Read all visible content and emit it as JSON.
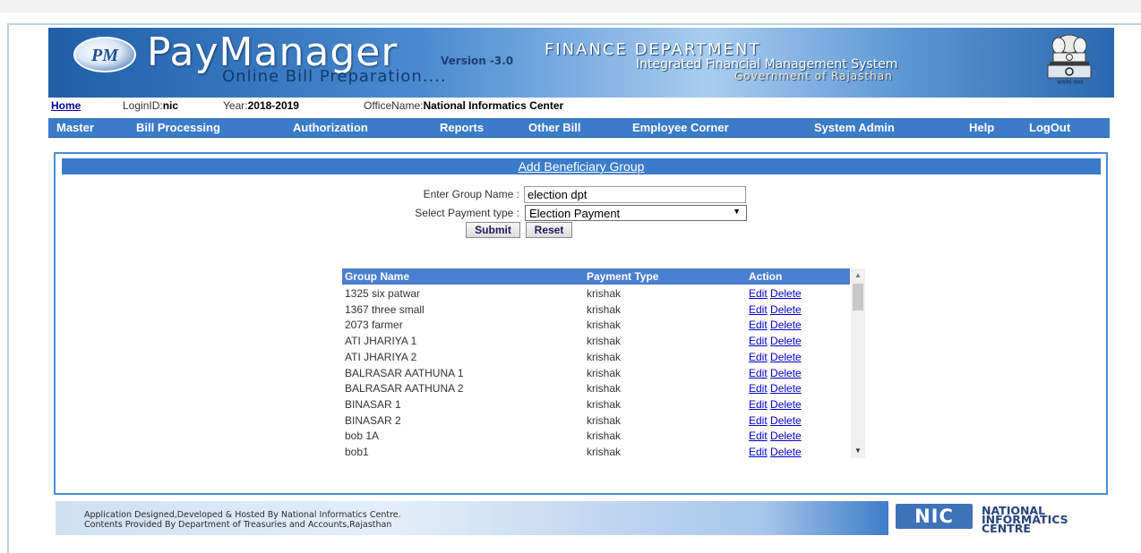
{
  "header": {
    "logo_initials": "PM",
    "brand": "PayManager",
    "version": "Version -3.0",
    "subtitle": "Online Bill Preparation....",
    "department": "FINANCE  DEPARTMENT",
    "system": "Integrated Financial Management System",
    "government": "Government of Rajasthan",
    "emblem_caption": "सत्यमेव जयते",
    "brand_color": "#1f5fa8"
  },
  "infobar": {
    "home_label": "Home",
    "login_label": "LoginID:",
    "login_value": "nic",
    "year_label": "Year:",
    "year_value": "2018-2019",
    "office_label": "OfficeName:",
    "office_value": "National Informatics Center"
  },
  "menu": {
    "items": [
      "Master",
      "Bill Processing",
      "Authorization",
      "Reports",
      "Other Bill",
      "Employee Corner",
      "System Admin",
      "Help",
      "LogOut"
    ]
  },
  "panel": {
    "title": "Add Beneficiary Group"
  },
  "form": {
    "group_name_label": "Enter Group Name :",
    "group_name_value": "election dpt",
    "payment_type_label": "Select Payment type :",
    "payment_type_value": "Election Payment",
    "submit_label": "Submit",
    "reset_label": "Reset"
  },
  "grid": {
    "columns": [
      "Group Name",
      "Payment Type",
      "Action"
    ],
    "edit_label": "Edit",
    "delete_label": "Delete",
    "rows": [
      {
        "name": "1325 six patwar",
        "type": "krishak"
      },
      {
        "name": "1367 three small",
        "type": "krishak"
      },
      {
        "name": "2073 farmer",
        "type": "krishak"
      },
      {
        "name": "ATI JHARIYA 1",
        "type": "krishak"
      },
      {
        "name": "ATI JHARIYA 2",
        "type": "krishak"
      },
      {
        "name": "BALRASAR AATHUNA 1",
        "type": "krishak"
      },
      {
        "name": "BALRASAR AATHUNA 2",
        "type": "krishak"
      },
      {
        "name": "BINASAR 1",
        "type": "krishak"
      },
      {
        "name": "BINASAR 2",
        "type": "krishak"
      },
      {
        "name": "bob 1A",
        "type": "krishak"
      },
      {
        "name": "bob1",
        "type": "krishak"
      }
    ],
    "header_color": "#4a7fd0",
    "link_color": "#0000cc"
  },
  "footer": {
    "line1": "Application Designed,Developed & Hosted By National Informatics Centre.",
    "line2": "Contents Provided By Department of  Treasuries and Accounts,Rajasthan",
    "nic_logo": "NIC",
    "nic_line1": "NATIONAL",
    "nic_line2": "INFORMATICS",
    "nic_line3": "CENTRE"
  }
}
